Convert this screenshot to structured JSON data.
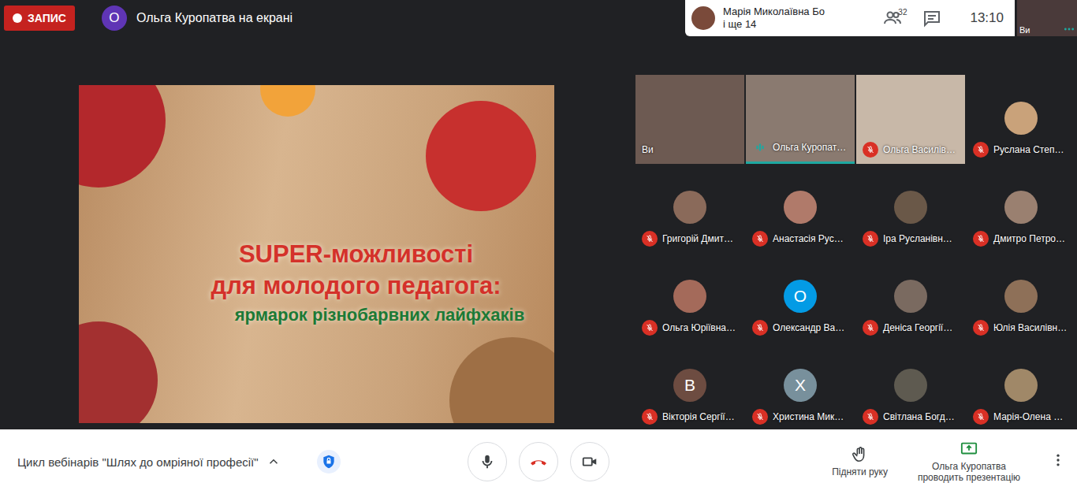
{
  "recording": {
    "label": "ЗАПИС",
    "on": true
  },
  "presenter_banner": {
    "initial": "О",
    "text": "Ольга Куропатва на екрані"
  },
  "people_panel": {
    "name": "Марія Миколаївна Бо",
    "more": "і ще 14",
    "count": "32",
    "time": "13:10"
  },
  "self_view": {
    "label": "Ви"
  },
  "slide": {
    "lines": [
      "SUPER-можливості",
      "для молодого педагога:",
      "ярмарок різнобарвних лайфхаків"
    ]
  },
  "participants": [
    {
      "name": "Ви",
      "kind": "video",
      "muted": false,
      "speaking": false
    },
    {
      "name": "Ольга Куропат…",
      "kind": "video",
      "muted": false,
      "speaking": true
    },
    {
      "name": "Ольга Василів…",
      "kind": "video",
      "muted": true,
      "speaking": false
    },
    {
      "name": "Руслана Степ…",
      "kind": "photo",
      "muted": true,
      "speaking": false
    },
    {
      "name": "Григорій Дмит…",
      "kind": "photo",
      "muted": true,
      "speaking": false
    },
    {
      "name": "Анастасія Рус…",
      "kind": "photo",
      "muted": true,
      "speaking": false
    },
    {
      "name": "Іра Русланівн…",
      "kind": "photo",
      "muted": true,
      "speaking": false
    },
    {
      "name": "Дмитро Петро…",
      "kind": "photo",
      "muted": true,
      "speaking": false
    },
    {
      "name": "Ольга Юріївна…",
      "kind": "photo",
      "muted": true,
      "speaking": false
    },
    {
      "name": "Олександр Ва…",
      "kind": "initial",
      "initial": "О",
      "color": "#039be5",
      "muted": true,
      "speaking": false
    },
    {
      "name": "Деніса Георгії…",
      "kind": "photo",
      "muted": true,
      "speaking": false
    },
    {
      "name": "Юлія Василівн…",
      "kind": "photo",
      "muted": true,
      "speaking": false
    },
    {
      "name": "Вікторія Сергії…",
      "kind": "initial",
      "initial": "В",
      "color": "#6d4c41",
      "muted": true,
      "speaking": false
    },
    {
      "name": "Христина Мик…",
      "kind": "initial",
      "initial": "Х",
      "color": "#78909c",
      "muted": true,
      "speaking": false
    },
    {
      "name": "Світлана Богд…",
      "kind": "photo",
      "muted": true,
      "speaking": false
    },
    {
      "name": "Марія-Олена …",
      "kind": "photo",
      "muted": true,
      "speaking": false
    }
  ],
  "bottom": {
    "meeting_title": "Цикл вебінарів \"Шлях до омріяної професії\"",
    "raise_hand": "Підняти руку",
    "presenting": "Ольга Куропатва проводить презентацію"
  }
}
